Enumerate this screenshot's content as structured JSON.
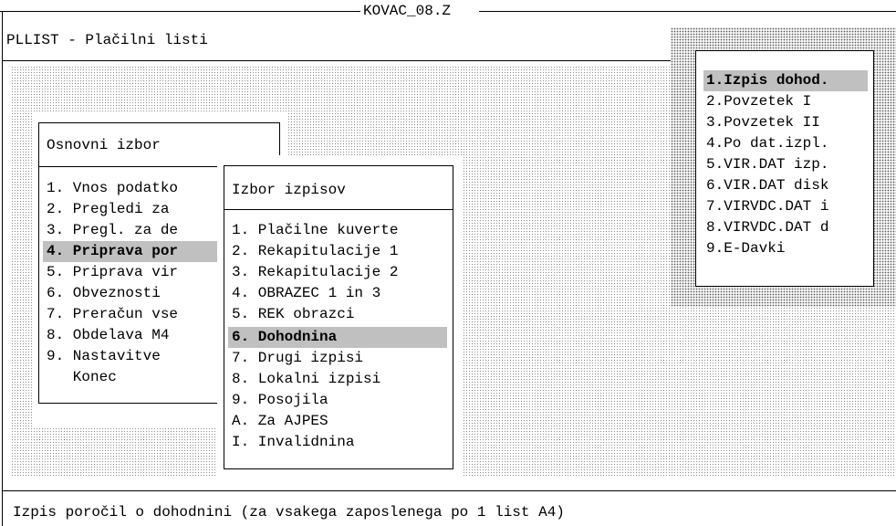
{
  "window": {
    "title": "KOVAC_08.Z",
    "program_title": "PLLIST - Plačilni listi"
  },
  "main_menu": {
    "title": "Osnovni izbor",
    "items": [
      "1. Vnos podatko",
      "2. Pregledi za",
      "3. Pregl. za de",
      "4. Priprava por",
      "5. Priprava vir",
      "6. Obveznosti",
      "7. Preračun vse",
      "8. Obdelava M4",
      "9. Nastavitve",
      "   Konec"
    ],
    "selected_index": 3
  },
  "report_menu": {
    "title": "Izbor izpisov",
    "items": [
      "1. Plačilne kuverte",
      "2. Rekapitulacije 1",
      "3. Rekapitulacije 2",
      "4. OBRAZEC 1 in 3",
      "5. REK obrazci",
      "6. Dohodnina",
      "7. Drugi izpisi",
      "8. Lokalni izpisi",
      "9. Posojila",
      "A. Za AJPES",
      "I. Invalidnina"
    ],
    "selected_index": 5
  },
  "income_menu": {
    "items": [
      "1.Izpis dohod.",
      "2.Povzetek I",
      "3.Povzetek II",
      "4.Po dat.izpl.",
      "5.VIR.DAT izp.",
      "6.VIR.DAT disk",
      "7.VIRVDC.DAT i",
      "8.VIRVDC.DAT d",
      "9.E-Davki"
    ],
    "selected_index": 0
  },
  "status_bar": {
    "text": "Izpis poročil o dohodnini (za vsakega zaposlenega po 1 list A4)"
  }
}
